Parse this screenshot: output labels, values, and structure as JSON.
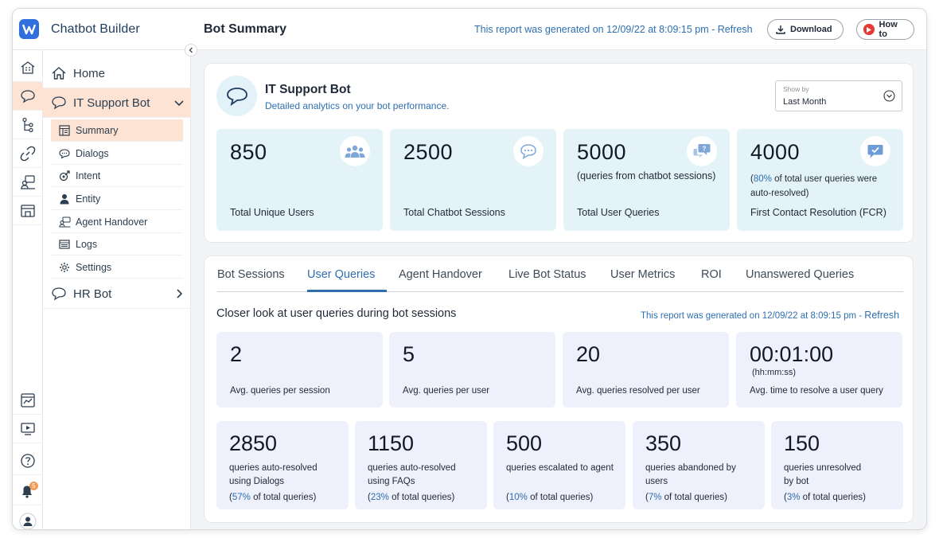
{
  "app": {
    "title": "Chatbot Builder"
  },
  "header": {
    "page_title": "Bot Summary",
    "report_text": "This report was generated on 12/09/22 at 8:09:15 pm - ",
    "refresh": "Refresh",
    "download": "Download",
    "howto": "How to"
  },
  "sidebar": {
    "home": "Home",
    "bot1": "IT Support Bot",
    "items": [
      {
        "label": "Summary"
      },
      {
        "label": "Dialogs"
      },
      {
        "label": "Intent"
      },
      {
        "label": "Entity"
      },
      {
        "label": "Agent Handover"
      },
      {
        "label": "Logs"
      },
      {
        "label": "Settings"
      }
    ],
    "bot2": "HR Bot"
  },
  "rail": {
    "notification_count": "5"
  },
  "overview": {
    "name": "IT Support Bot",
    "desc": "Detailed analytics on your bot performance.",
    "showby_label": "Show by",
    "showby_value": "Last Month",
    "stats": [
      {
        "value": "850",
        "label": "Total Unique Users"
      },
      {
        "value": "2500",
        "label": "Total Chatbot Sessions"
      },
      {
        "value": "5000",
        "note": "(queries from chatbot sessions)",
        "label": "Total User Queries"
      },
      {
        "value": "4000",
        "note_open": "(",
        "note_pct": "80%",
        "note_rest": " of total user queries were auto-resolved)",
        "label": "First Contact Resolution (FCR)"
      }
    ]
  },
  "tabs": [
    "Bot Sessions",
    "User Queries",
    "Agent Handover",
    "Live Bot Status",
    "User Metrics",
    "ROI",
    "Unanswered Queries"
  ],
  "queries": {
    "section_title": "Closer look at user queries during bot sessions",
    "report_text": "This report was generated on 12/09/22 at 8:09:15 pm - ",
    "refresh": "Refresh",
    "row1": [
      {
        "value": "2",
        "label": "Avg. queries per session"
      },
      {
        "value": "5",
        "label": "Avg. queries per user"
      },
      {
        "value": "20",
        "label": "Avg. queries resolved per user"
      },
      {
        "value": "00:01:00",
        "unit": "(hh:mm:ss)",
        "label": "Avg. time to resolve a user query"
      }
    ],
    "row2": [
      {
        "value": "2850",
        "desc": "queries auto-resolved using Dialogs",
        "pct": "57%",
        "pct_rest": " of total queries)"
      },
      {
        "value": "1150",
        "desc": "queries auto-resolved using FAQs",
        "pct": "23%",
        "pct_rest": " of total queries)"
      },
      {
        "value": "500",
        "desc": "queries escalated to agent",
        "pct": "10%",
        "pct_rest": " of total queries)"
      },
      {
        "value": "350",
        "desc": "queries abandoned by users",
        "pct": "7%",
        "pct_rest": " of total queries)"
      },
      {
        "value": "150",
        "desc": "queries unresolved by bot",
        "pct": "3%",
        "pct_rest": " of total queries)"
      }
    ],
    "pct_open": "("
  }
}
